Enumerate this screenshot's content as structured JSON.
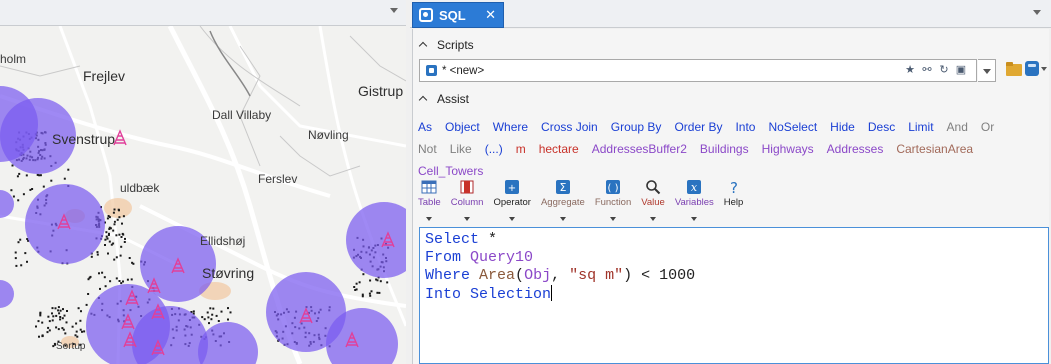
{
  "map": {
    "places": {
      "holm": "holm",
      "frejlev": "Frejlev",
      "gistrup": "Gistrup",
      "svenstrup": "Svenstrup",
      "dall_villaby": "Dall Villaby",
      "noevling": "Nøvling",
      "guldbaek": "uldbæk",
      "ferslev": "Ferslev",
      "ellidshoej": "Ellidshøj",
      "stoevring": "Støvring",
      "sortup": "Sortup"
    },
    "colors": {
      "buffer_fill": "#7a5cf0",
      "tower_icon": "#e0409a",
      "town_area": "#f2c8a0",
      "road": "#ffffff"
    }
  },
  "sql_tab": {
    "title": "SQL",
    "close_glyph": "✕",
    "icon": "sql-tab-icon"
  },
  "scripts": {
    "header": "Scripts",
    "selected_script": "* <new>",
    "icons": [
      "star-icon",
      "tree-icon",
      "refresh-icon",
      "save-icon"
    ]
  },
  "assist": {
    "header": "Assist",
    "keywords_row1": [
      {
        "label": "As",
        "style": "blue"
      },
      {
        "label": "Object",
        "style": "blue"
      },
      {
        "label": "Where",
        "style": "blue"
      },
      {
        "label": "Cross Join",
        "style": "blue"
      },
      {
        "label": "Group By",
        "style": "blue"
      },
      {
        "label": "Order By",
        "style": "blue"
      },
      {
        "label": "Into",
        "style": "blue"
      },
      {
        "label": "NoSelect",
        "style": "blue"
      },
      {
        "label": "Hide",
        "style": "blue"
      },
      {
        "label": "Desc",
        "style": "blue"
      },
      {
        "label": "Limit",
        "style": "blue"
      },
      {
        "label": "And",
        "style": "gray"
      },
      {
        "label": "Or",
        "style": "gray"
      }
    ],
    "keywords_row2": [
      {
        "label": "Not",
        "style": "gray"
      },
      {
        "label": "Like",
        "style": "gray"
      },
      {
        "label": "(...)",
        "style": "blue"
      },
      {
        "label": "m",
        "style": "red"
      },
      {
        "label": "hectare",
        "style": "red"
      },
      {
        "label": "AddressesBuffer2",
        "style": "purple"
      },
      {
        "label": "Buildings",
        "style": "purple"
      },
      {
        "label": "Highways",
        "style": "purple"
      },
      {
        "label": "Addresses",
        "style": "purple"
      },
      {
        "label": "CartesianArea",
        "style": "brown"
      }
    ],
    "keywords_row3": [
      {
        "label": "Cell_Towers",
        "style": "purple"
      }
    ],
    "toolbar": {
      "table": "Table",
      "column": "Column",
      "operator": "Operator",
      "aggregate": "Aggregate",
      "function": "Function",
      "value": "Value",
      "variables": "Variables",
      "help": "Help"
    },
    "toolbar_colors": {
      "table": "#7a3fb0",
      "column": "#7a3fb0",
      "operator": "#222222",
      "aggregate": "#8a6a60",
      "function": "#8a6a60",
      "value": "#b03a2e",
      "variables": "#7a3fb0",
      "help": "#222222"
    }
  },
  "editor": {
    "line1_kw": "Select",
    "line1_rest": " *",
    "line2_kw": "From",
    "line2_id": "Query10",
    "line3_kw": "Where",
    "line3_fn": "Area",
    "line3_open": "(",
    "line3_id": "Obj",
    "line3_comma": ", ",
    "line3_str": "\"sq m\"",
    "line3_rest": ") < 1000",
    "line4_kw1": "Into",
    "line4_kw2": "Selection"
  }
}
